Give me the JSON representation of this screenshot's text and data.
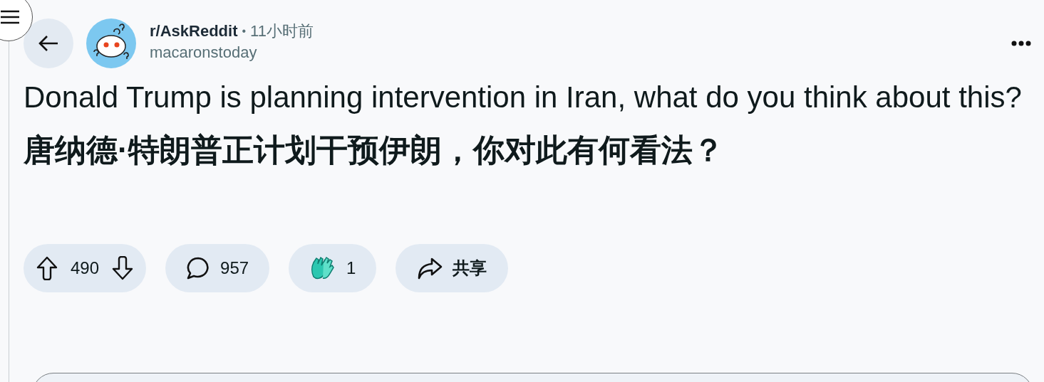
{
  "subreddit": "r/AskReddit",
  "separator": "•",
  "time": "11小时前",
  "author": "macaronstoday",
  "title": "Donald Trump is planning intervention in Iran, what do you think about this?",
  "title_translation": "唐纳德·特朗普正计划干预伊朗，你对此有何看法？",
  "actions": [
    {
      "kind": "vote",
      "count": "490"
    },
    {
      "kind": "comments",
      "count": "957"
    },
    {
      "kind": "award",
      "count": "1"
    },
    {
      "kind": "share",
      "label": "共享"
    }
  ]
}
